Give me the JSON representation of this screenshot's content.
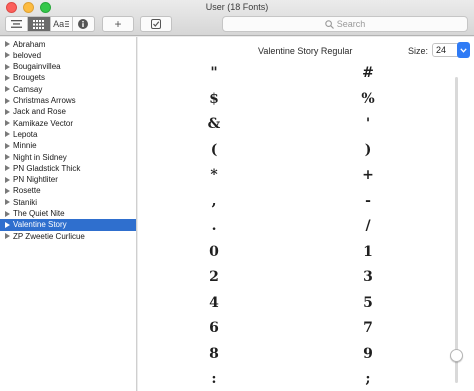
{
  "window": {
    "title": "User (18 Fonts)"
  },
  "toolbar": {
    "views": [
      "list-view",
      "grid-view",
      "sample-view",
      "info"
    ],
    "sample_label": "Aa",
    "add_label": "+",
    "search_placeholder": "Search"
  },
  "sidebar": {
    "families": [
      {
        "label": "Abraham"
      },
      {
        "label": "beloved"
      },
      {
        "label": "Bougainvillea"
      },
      {
        "label": "Brougets"
      },
      {
        "label": "Camsay"
      },
      {
        "label": "Christmas Arrows"
      },
      {
        "label": "Jack and Rose"
      },
      {
        "label": "Kamikaze Vector"
      },
      {
        "label": "Lepota"
      },
      {
        "label": "Minnie"
      },
      {
        "label": "Night in Sidney"
      },
      {
        "label": "PN Gladstick Thick"
      },
      {
        "label": "PN Nightliter"
      },
      {
        "label": "Rosette"
      },
      {
        "label": "Staniki"
      },
      {
        "label": "The Quiet Nite"
      },
      {
        "label": "Valentine Story"
      },
      {
        "label": "ZP Zweetie Curlicue"
      }
    ],
    "selected": "Valentine Story"
  },
  "preview": {
    "font_name": "Valentine Story Regular",
    "size_label": "Size:",
    "size_value": "24",
    "left_glyphs": [
      "\"",
      "$",
      "&",
      "(",
      "*",
      ",",
      ".",
      "0",
      "2",
      "4",
      "6",
      "8",
      ":"
    ],
    "right_glyphs": [
      "#",
      "%",
      "'",
      ")",
      "+",
      "-",
      "/",
      "1",
      "3",
      "5",
      "7",
      "9",
      ";"
    ]
  },
  "colors": {
    "selection": "#2f6fce",
    "accent": "#2f7bf5"
  }
}
